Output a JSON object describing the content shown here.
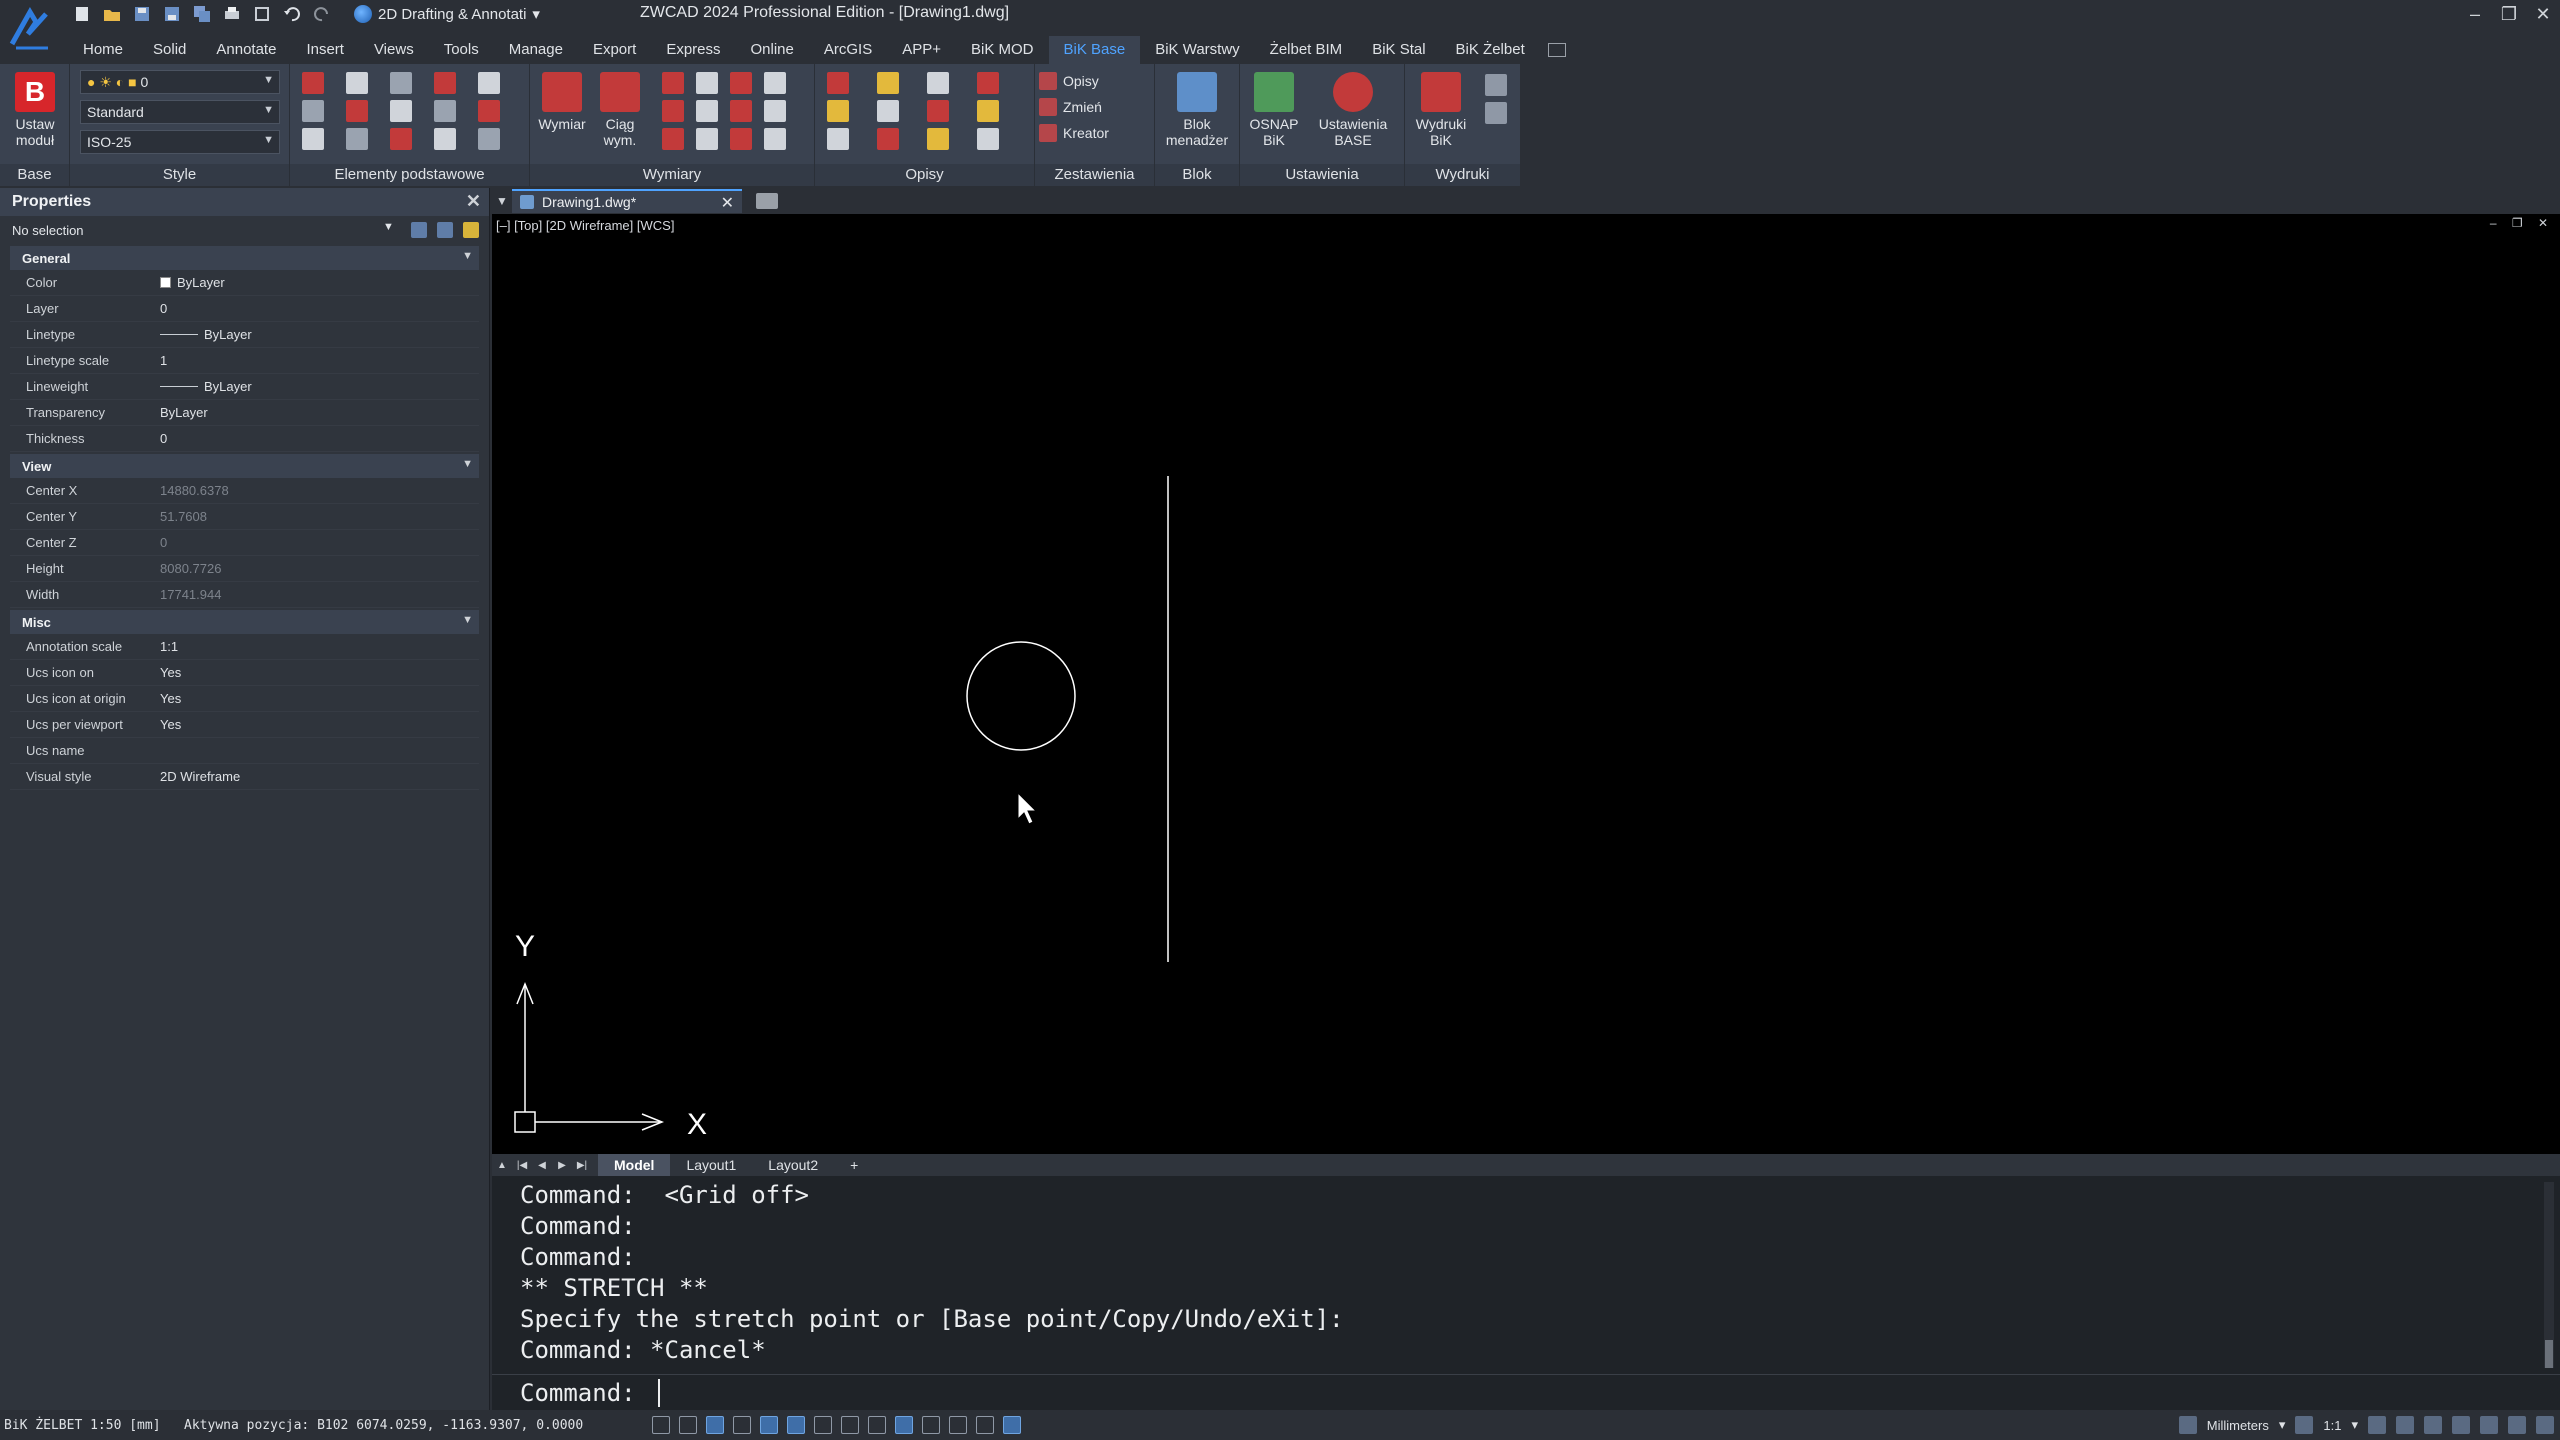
{
  "titlebar": {
    "workspace": "2D Drafting & Annotati",
    "title": "ZWCAD 2024 Professional Edition - [Drawing1.dwg]"
  },
  "ribbon_tabs": [
    "Home",
    "Solid",
    "Annotate",
    "Insert",
    "Views",
    "Tools",
    "Manage",
    "Export",
    "Express",
    "Online",
    "ArcGIS",
    "APP+",
    "BiK MOD",
    "BiK Base",
    "BiK Warstwy",
    "Żelbet BIM",
    "BiK Stal",
    "BiK Żelbet"
  ],
  "active_tab": "BiK Base",
  "ribbon": {
    "base": {
      "title": "Base",
      "button": "Ustaw\nmoduł"
    },
    "style": {
      "title": "Style",
      "layer": "0",
      "text_style": "Standard",
      "dim_style": "ISO-25"
    },
    "elementy": {
      "title": "Elementy podstawowe"
    },
    "wymiary": {
      "title": "Wymiary",
      "btn_wymiar": "Wymiar",
      "btn_ciag": "Ciąg\nwym."
    },
    "opisy": {
      "title": "Opisy"
    },
    "zestawienia": {
      "title": "Zestawienia",
      "items": [
        "Opisy",
        "Zmień",
        "Kreator"
      ]
    },
    "blok": {
      "title": "Blok menadżer",
      "button": "Blok\nmenadżer"
    },
    "ustawienia": {
      "title": "Ustawienia",
      "btn_osnap": "OSNAP\nBiK",
      "btn_ustawienia": "Ustawienia\nBASE"
    },
    "wydruki": {
      "title": "Wydruki",
      "button": "Wydruki\nBiK"
    }
  },
  "properties": {
    "title": "Properties",
    "selection": "No selection",
    "groups": [
      {
        "name": "General",
        "rows": [
          {
            "key": "Color",
            "value": "ByLayer",
            "type": "color"
          },
          {
            "key": "Layer",
            "value": "0"
          },
          {
            "key": "Linetype",
            "value": "ByLayer",
            "type": "line"
          },
          {
            "key": "Linetype scale",
            "value": "1"
          },
          {
            "key": "Lineweight",
            "value": "ByLayer",
            "type": "line"
          },
          {
            "key": "Transparency",
            "value": "ByLayer"
          },
          {
            "key": "Thickness",
            "value": "0"
          }
        ]
      },
      {
        "name": "View",
        "rows": [
          {
            "key": "Center X",
            "value": "14880.6378",
            "dim": true
          },
          {
            "key": "Center Y",
            "value": "51.7608",
            "dim": true
          },
          {
            "key": "Center Z",
            "value": "0",
            "dim": true
          },
          {
            "key": "Height",
            "value": "8080.7726",
            "dim": true
          },
          {
            "key": "Width",
            "value": "17741.944",
            "dim": true
          }
        ]
      },
      {
        "name": "Misc",
        "rows": [
          {
            "key": "Annotation scale",
            "value": "1:1"
          },
          {
            "key": "Ucs icon on",
            "value": "Yes"
          },
          {
            "key": "Ucs icon at origin",
            "value": "Yes"
          },
          {
            "key": "Ucs per viewport",
            "value": "Yes"
          },
          {
            "key": "Ucs name",
            "value": ""
          },
          {
            "key": "Visual style",
            "value": "2D Wireframe"
          }
        ]
      }
    ]
  },
  "document_tab": "Drawing1.dwg*",
  "viewport_label": "[–] [Top] [2D Wireframe] [WCS]",
  "ucs": {
    "x_label": "X",
    "y_label": "Y"
  },
  "layout_tabs": [
    "Model",
    "Layout1",
    "Layout2",
    "+"
  ],
  "command_history": [
    "Command:  <Grid off>",
    "Command:",
    "Command:",
    "** STRETCH **",
    "Specify the stretch point or [Base point/Copy/Undo/eXit]:",
    "Command: *Cancel*"
  ],
  "command_prompt": "Command:",
  "status": {
    "left": "BiK ŻELBET 1:50 [mm]   Aktywna pozycja: B102 6074.0259, -1163.9307, 0.0000",
    "units": "Millimeters",
    "scale": "1:1"
  },
  "colors": {
    "accent": "#4fa3ff",
    "canvas": "#000000",
    "ribbon": "#3a4250"
  }
}
